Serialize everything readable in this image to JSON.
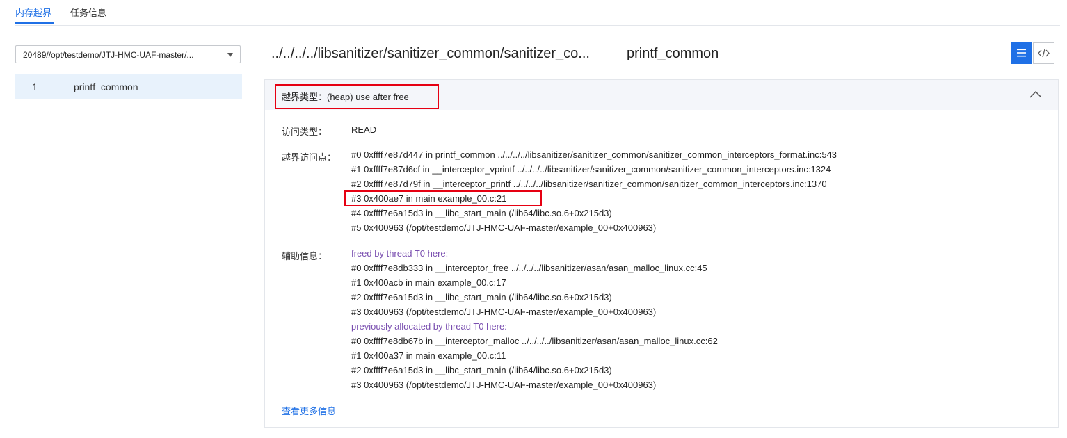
{
  "tabs": [
    {
      "label": "内存越界",
      "active": true
    },
    {
      "label": "任务信息",
      "active": false
    }
  ],
  "sidebar": {
    "select_value": "20489//opt/testdemo/JTJ-HMC-UAF-master/...",
    "items": [
      {
        "index": "1",
        "name": "printf_common"
      }
    ]
  },
  "header": {
    "file_path": "../../../../libsanitizer/sanitizer_common/sanitizer_co...",
    "function": "printf_common"
  },
  "detail": {
    "overflow_type": "越界类型：(heap) use after free",
    "access_type_label": "访问类型：",
    "access_type_value": "READ",
    "access_point_label": "越界访问点：",
    "access_point_lines": [
      "#0 0xffff7e87d447 in printf_common ../../../../libsanitizer/sanitizer_common/sanitizer_common_interceptors_format.inc:543",
      "#1 0xffff7e87d6cf in __interceptor_vprintf ../../../../libsanitizer/sanitizer_common/sanitizer_common_interceptors.inc:1324",
      "#2 0xffff7e87d79f in __interceptor_printf ../../../../libsanitizer/sanitizer_common/sanitizer_common_interceptors.inc:1370",
      "#3 0x400ae7 in main example_00.c:21",
      "#4 0xffff7e6a15d3 in __libc_start_main (/lib64/libc.so.6+0x215d3)",
      "#5 0x400963 (/opt/testdemo/JTJ-HMC-UAF-master/example_00+0x400963)"
    ],
    "aux_label": "辅助信息：",
    "aux_lines": [
      {
        "text": "freed by thread T0 here:",
        "heading": true
      },
      {
        "text": "#0 0xffff7e8db333 in __interceptor_free ../../../../libsanitizer/asan/asan_malloc_linux.cc:45",
        "heading": false
      },
      {
        "text": "#1 0x400acb in main example_00.c:17",
        "heading": false
      },
      {
        "text": "#2 0xffff7e6a15d3 in __libc_start_main (/lib64/libc.so.6+0x215d3)",
        "heading": false
      },
      {
        "text": "#3 0x400963 (/opt/testdemo/JTJ-HMC-UAF-master/example_00+0x400963)",
        "heading": false
      },
      {
        "text": "previously allocated by thread T0 here:",
        "heading": true
      },
      {
        "text": "#0 0xffff7e8db67b in __interceptor_malloc ../../../../libsanitizer/asan/asan_malloc_linux.cc:62",
        "heading": false
      },
      {
        "text": "#1 0x400a37 in main example_00.c:11",
        "heading": false
      },
      {
        "text": "#2 0xffff7e6a15d3 in __libc_start_main (/lib64/libc.so.6+0x215d3)",
        "heading": false
      },
      {
        "text": "#3 0x400963 (/opt/testdemo/JTJ-HMC-UAF-master/example_00+0x400963)",
        "heading": false
      }
    ],
    "more_link": "查看更多信息"
  },
  "colors": {
    "accent": "#1f70e6",
    "highlight": "#e60012",
    "heading_purple": "#7a4fb0",
    "selected_bg": "#e8f2fc"
  },
  "icons": {
    "list_view": "list-view-icon",
    "code_view": "code-view-icon",
    "collapse": "chevron-up-icon",
    "select_caret": "caret-down-icon"
  }
}
